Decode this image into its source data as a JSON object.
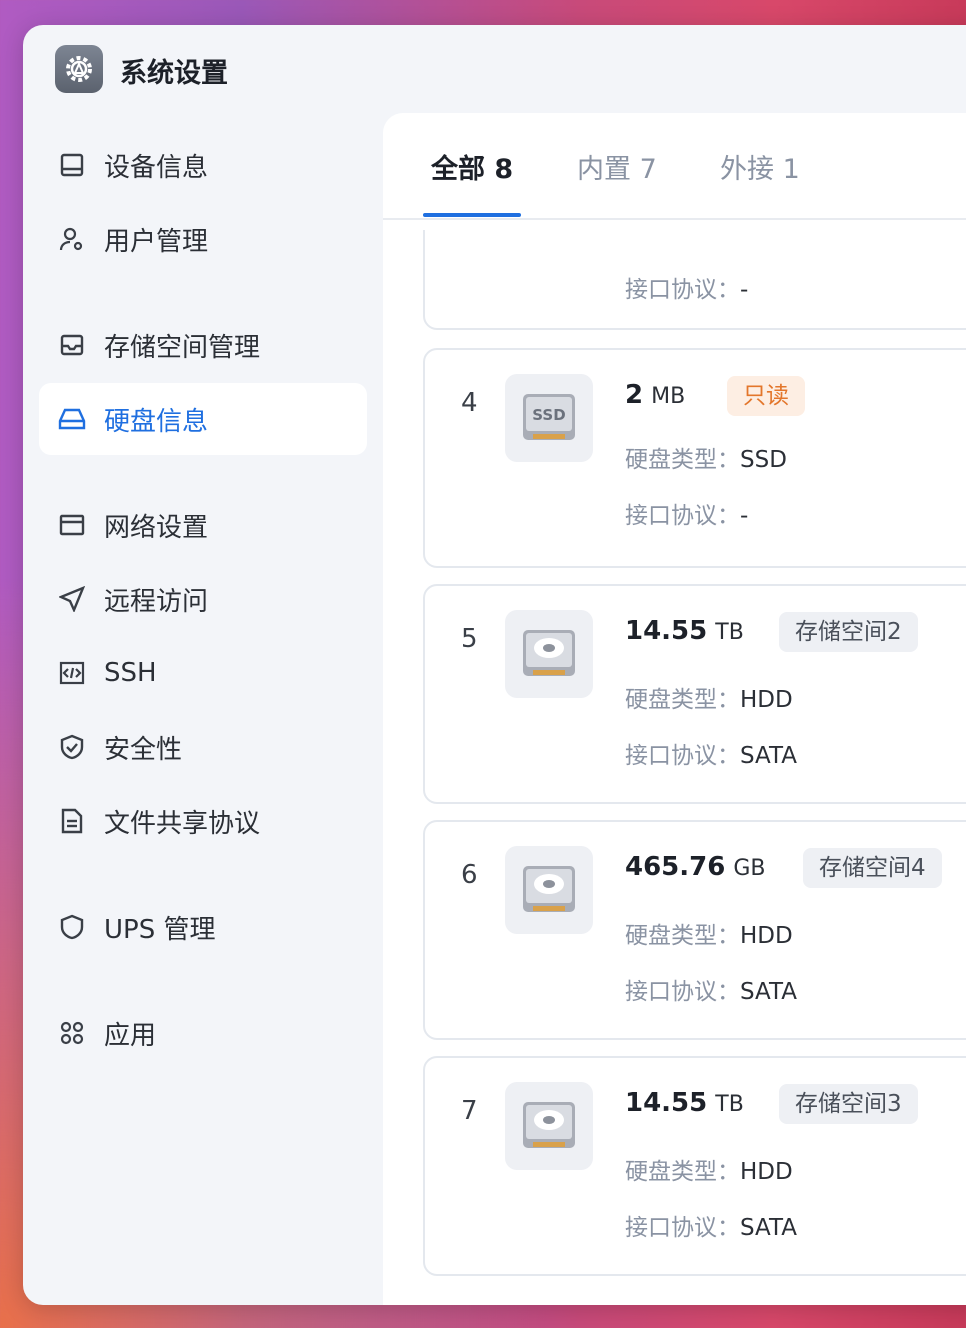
{
  "app": {
    "title": "系统设置",
    "icon": "gear-icon"
  },
  "nav": [
    {
      "label": "设备信息",
      "icon": "monitor-icon",
      "active": false
    },
    {
      "label": "用户管理",
      "icon": "user-gear-icon",
      "active": false
    },
    {
      "label": "存储空间管理",
      "icon": "inbox-icon",
      "active": false
    },
    {
      "label": "硬盘信息",
      "icon": "drive-icon",
      "active": true
    },
    {
      "label": "网络设置",
      "icon": "window-icon",
      "active": false
    },
    {
      "label": "远程访问",
      "icon": "send-icon",
      "active": false
    },
    {
      "label": "SSH",
      "icon": "code-icon",
      "active": false
    },
    {
      "label": "安全性",
      "icon": "shield-check-icon",
      "active": false
    },
    {
      "label": "文件共享协议",
      "icon": "document-icon",
      "active": false
    },
    {
      "label": "UPS 管理",
      "icon": "shield-icon",
      "active": false
    },
    {
      "label": "应用",
      "icon": "command-icon",
      "active": false
    }
  ],
  "tabs": [
    {
      "label": "全部 8",
      "active": true
    },
    {
      "label": "内置 7",
      "active": false
    },
    {
      "label": "外接 1",
      "active": false
    }
  ],
  "labels": {
    "type": "硬盘类型：",
    "protocol": "接口协议："
  },
  "partial_card": {
    "protocol": "-"
  },
  "disks": [
    {
      "index": "4",
      "kind": "SSD",
      "size": "2",
      "unit": "MB",
      "badge": "只读",
      "badge_style": "orange",
      "type": "SSD",
      "protocol": "-"
    },
    {
      "index": "5",
      "kind": "HDD",
      "size": "14.55",
      "unit": "TB",
      "badge": "存储空间2",
      "badge_style": "gray",
      "type": "HDD",
      "protocol": "SATA"
    },
    {
      "index": "6",
      "kind": "HDD",
      "size": "465.76",
      "unit": "GB",
      "badge": "存储空间4",
      "badge_style": "gray",
      "type": "HDD",
      "protocol": "SATA"
    },
    {
      "index": "7",
      "kind": "HDD",
      "size": "14.55",
      "unit": "TB",
      "badge": "存储空间3",
      "badge_style": "gray",
      "type": "HDD",
      "protocol": "SATA"
    }
  ]
}
